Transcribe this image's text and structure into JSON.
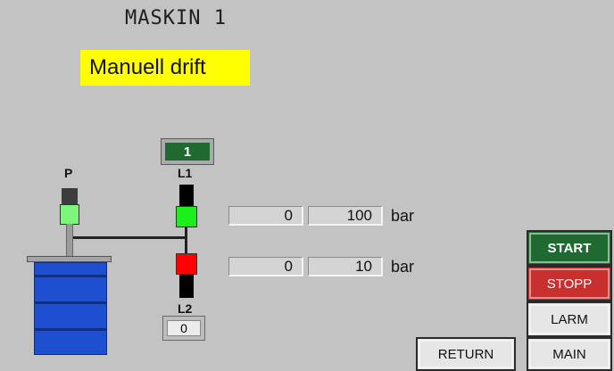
{
  "screen": {
    "title": "MASKIN 1",
    "mode_label": "Manuell drift"
  },
  "diagram": {
    "counter_value": "1",
    "pump_label": "P",
    "valve1_label": "L1",
    "valve2_label": "L2",
    "l2_value": "0",
    "pump_state_color": "#7df57d",
    "valve1_state_color": "#1cf01c",
    "valve2_state_color": "#ff0000"
  },
  "readouts": [
    {
      "actual": "0",
      "setpoint": "100",
      "unit": "bar"
    },
    {
      "actual": "0",
      "setpoint": "10",
      "unit": "bar"
    }
  ],
  "buttons": {
    "start": "START",
    "stopp": "STOPP",
    "larm": "LARM",
    "main": "MAIN",
    "return": "RETURN"
  },
  "colors": {
    "background": "#c3c3c3",
    "mode_highlight": "#ffff00",
    "start_green": "#1f6a30",
    "stopp_red": "#c83030",
    "barrel_blue": "#1e4fd0"
  }
}
